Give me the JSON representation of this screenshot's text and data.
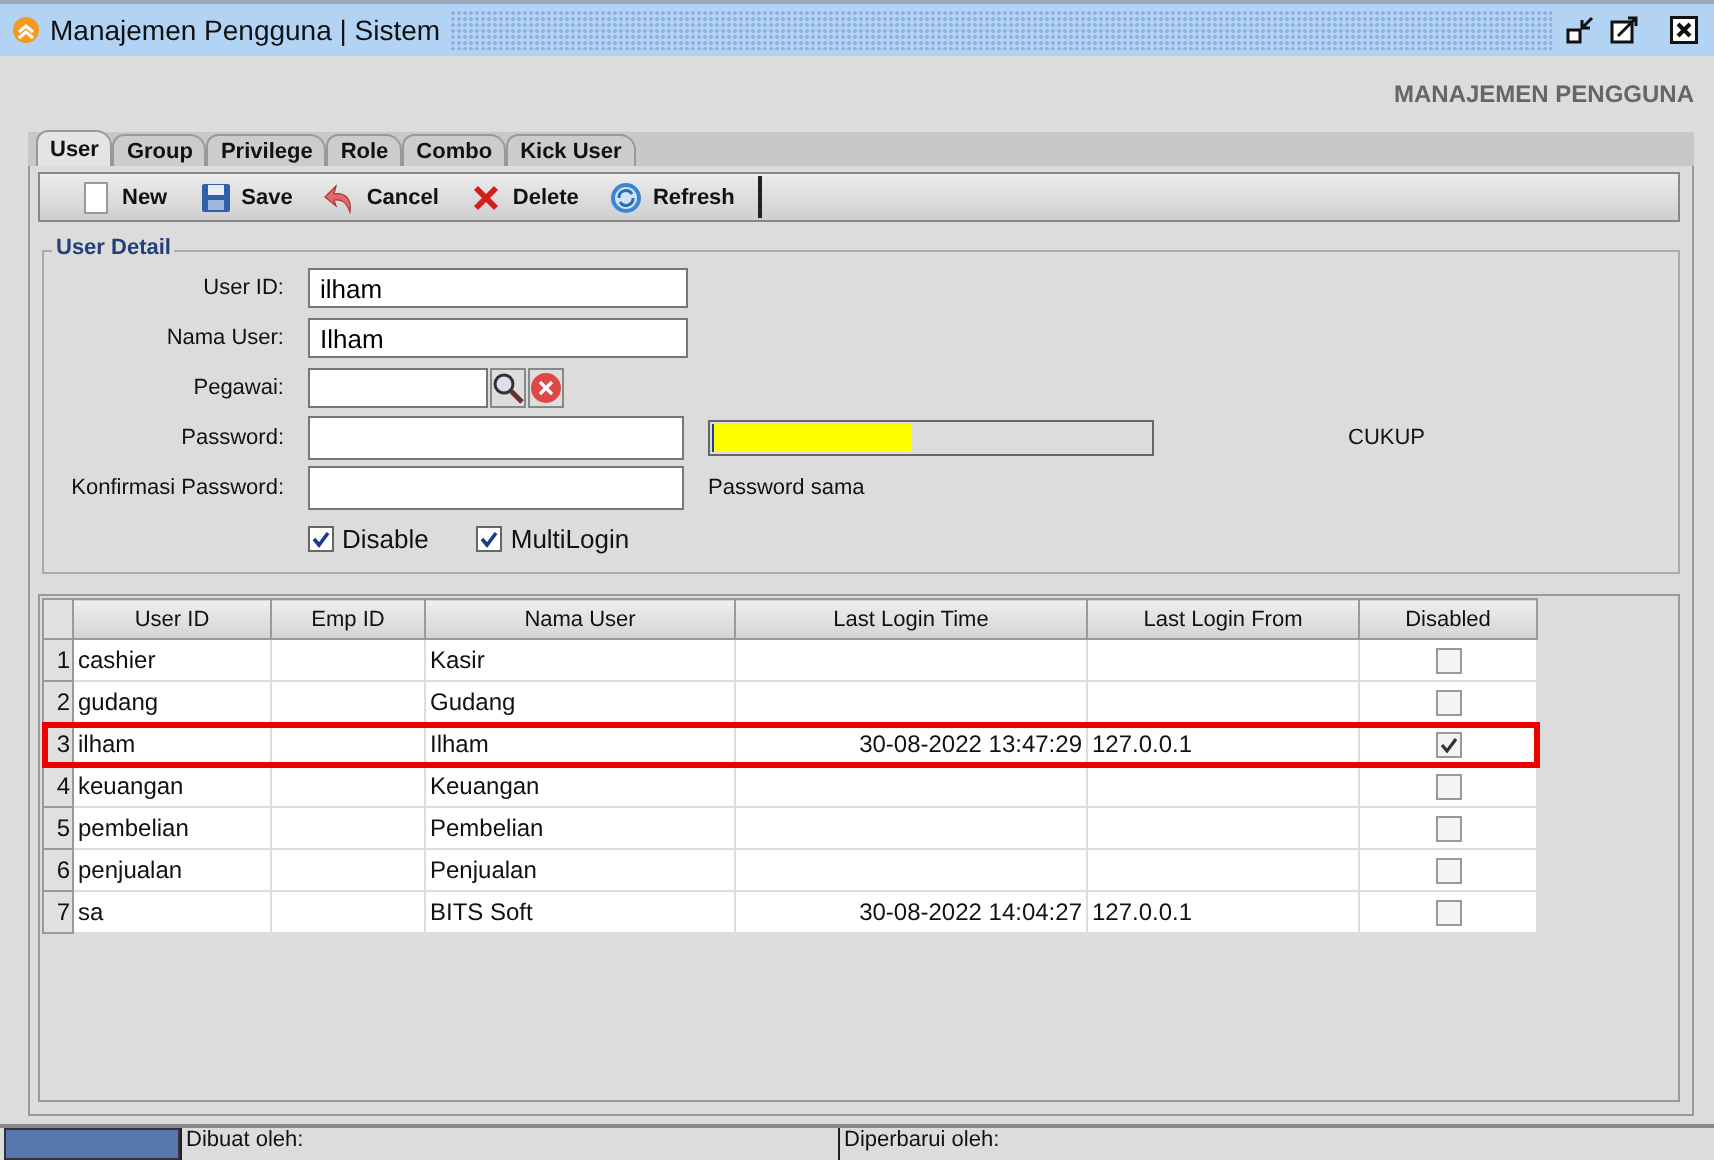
{
  "window": {
    "title": "Manajemen Pengguna | Sistem"
  },
  "header": "MANAJEMEN PENGGUNA",
  "tabs": [
    {
      "label": "User",
      "selected": true
    },
    {
      "label": "Group",
      "selected": false
    },
    {
      "label": "Privilege",
      "selected": false
    },
    {
      "label": "Role",
      "selected": false
    },
    {
      "label": "Combo",
      "selected": false
    },
    {
      "label": "Kick User",
      "selected": false
    }
  ],
  "toolbar": [
    {
      "kind": "new",
      "label": "New"
    },
    {
      "kind": "save",
      "label": "Save"
    },
    {
      "kind": "cancel",
      "label": "Cancel"
    },
    {
      "kind": "delete",
      "label": "Delete"
    },
    {
      "kind": "refresh",
      "label": "Refresh"
    }
  ],
  "user_detail": {
    "title": "User Detail",
    "user_id": {
      "label": "User ID:",
      "value": "ilham"
    },
    "nama_user": {
      "label": "Nama User:",
      "value": "Ilham"
    },
    "pegawai": {
      "label": "Pegawai:"
    },
    "password": {
      "label": "Password:",
      "strength": {
        "level": 0.45,
        "reading": "CUKUP"
      }
    },
    "konfirmasi": {
      "label": "Konfirmasi Password:",
      "note": "Password sama"
    },
    "checkboxes": [
      {
        "label": "Disable",
        "checked": true
      },
      {
        "label": "MultiLogin",
        "checked": true
      }
    ]
  },
  "table": {
    "columns": [
      "User ID",
      "Emp ID",
      "Nama User",
      "Last Login Time",
      "Last Login From",
      "Disabled"
    ],
    "rows": [
      {
        "number": "1",
        "user_id": "cashier",
        "nama_user": "Kasir",
        "disabled": false,
        "selected": false
      },
      {
        "number": "2",
        "user_id": "gudang",
        "nama_user": "Gudang",
        "disabled": false,
        "selected": false
      },
      {
        "number": "3",
        "user_id": "ilham",
        "nama_user": "Ilham",
        "last_login_time": "30-08-2022 13:47:29",
        "last_login_from": "127.0.0.1",
        "disabled": true,
        "selected": true
      },
      {
        "number": "4",
        "user_id": "keuangan",
        "nama_user": "Keuangan",
        "disabled": false,
        "selected": false
      },
      {
        "number": "5",
        "user_id": "pembelian",
        "nama_user": "Pembelian",
        "disabled": false,
        "selected": false
      },
      {
        "number": "6",
        "user_id": "penjualan",
        "nama_user": "Penjualan",
        "disabled": false,
        "selected": false
      },
      {
        "number": "7",
        "user_id": "sa",
        "nama_user": "BITS Soft",
        "last_login_time": "30-08-2022 14:04:27",
        "last_login_from": "127.0.0.1",
        "disabled": false,
        "selected": false
      }
    ]
  },
  "status_bar": {
    "created": "Dibuat oleh:",
    "updated": "Diperbarui oleh:"
  }
}
